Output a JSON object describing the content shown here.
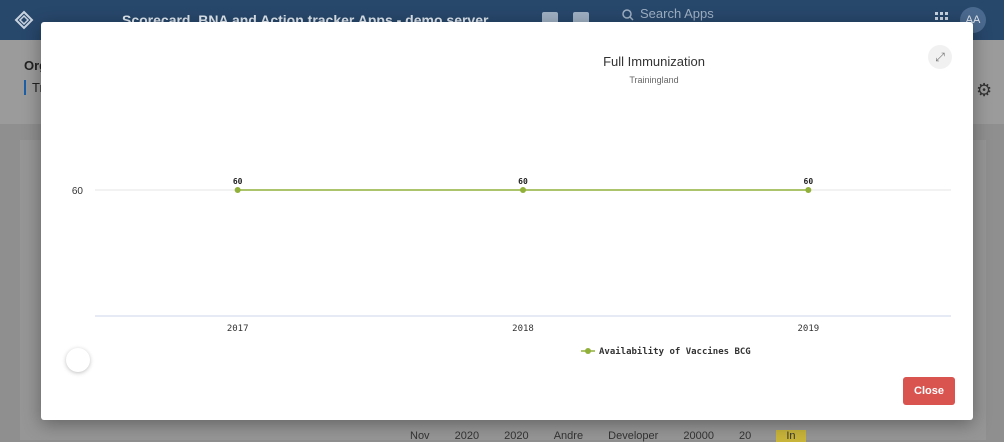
{
  "app": {
    "title": "Scorecard, BNA and Action tracker Apps - demo server",
    "search_placeholder": "Search Apps",
    "avatar_initials": "AA"
  },
  "background": {
    "org_label": "Org",
    "org_value": "Tr",
    "table_row": [
      "Nov",
      "2020",
      "2020",
      "Andre",
      "Developer",
      "20000",
      "20",
      "In"
    ]
  },
  "modal": {
    "close_label": "Close",
    "expand_icon": "expand-icon"
  },
  "chart_data": {
    "type": "line",
    "title": "Full Immunization",
    "subtitle": "Trainingland",
    "categories": [
      "2017",
      "2018",
      "2019"
    ],
    "series": [
      {
        "name": "Availability of Vaccines BCG",
        "values": [
          60,
          60,
          60
        ],
        "color": "#90b03a"
      }
    ],
    "y_ticks": [
      60
    ],
    "legend_position": "bottom-center",
    "data_labels": true,
    "grid": true
  },
  "colors": {
    "topbar": "#27476b",
    "close_button": "#d9534f",
    "series": "#90b03a"
  }
}
